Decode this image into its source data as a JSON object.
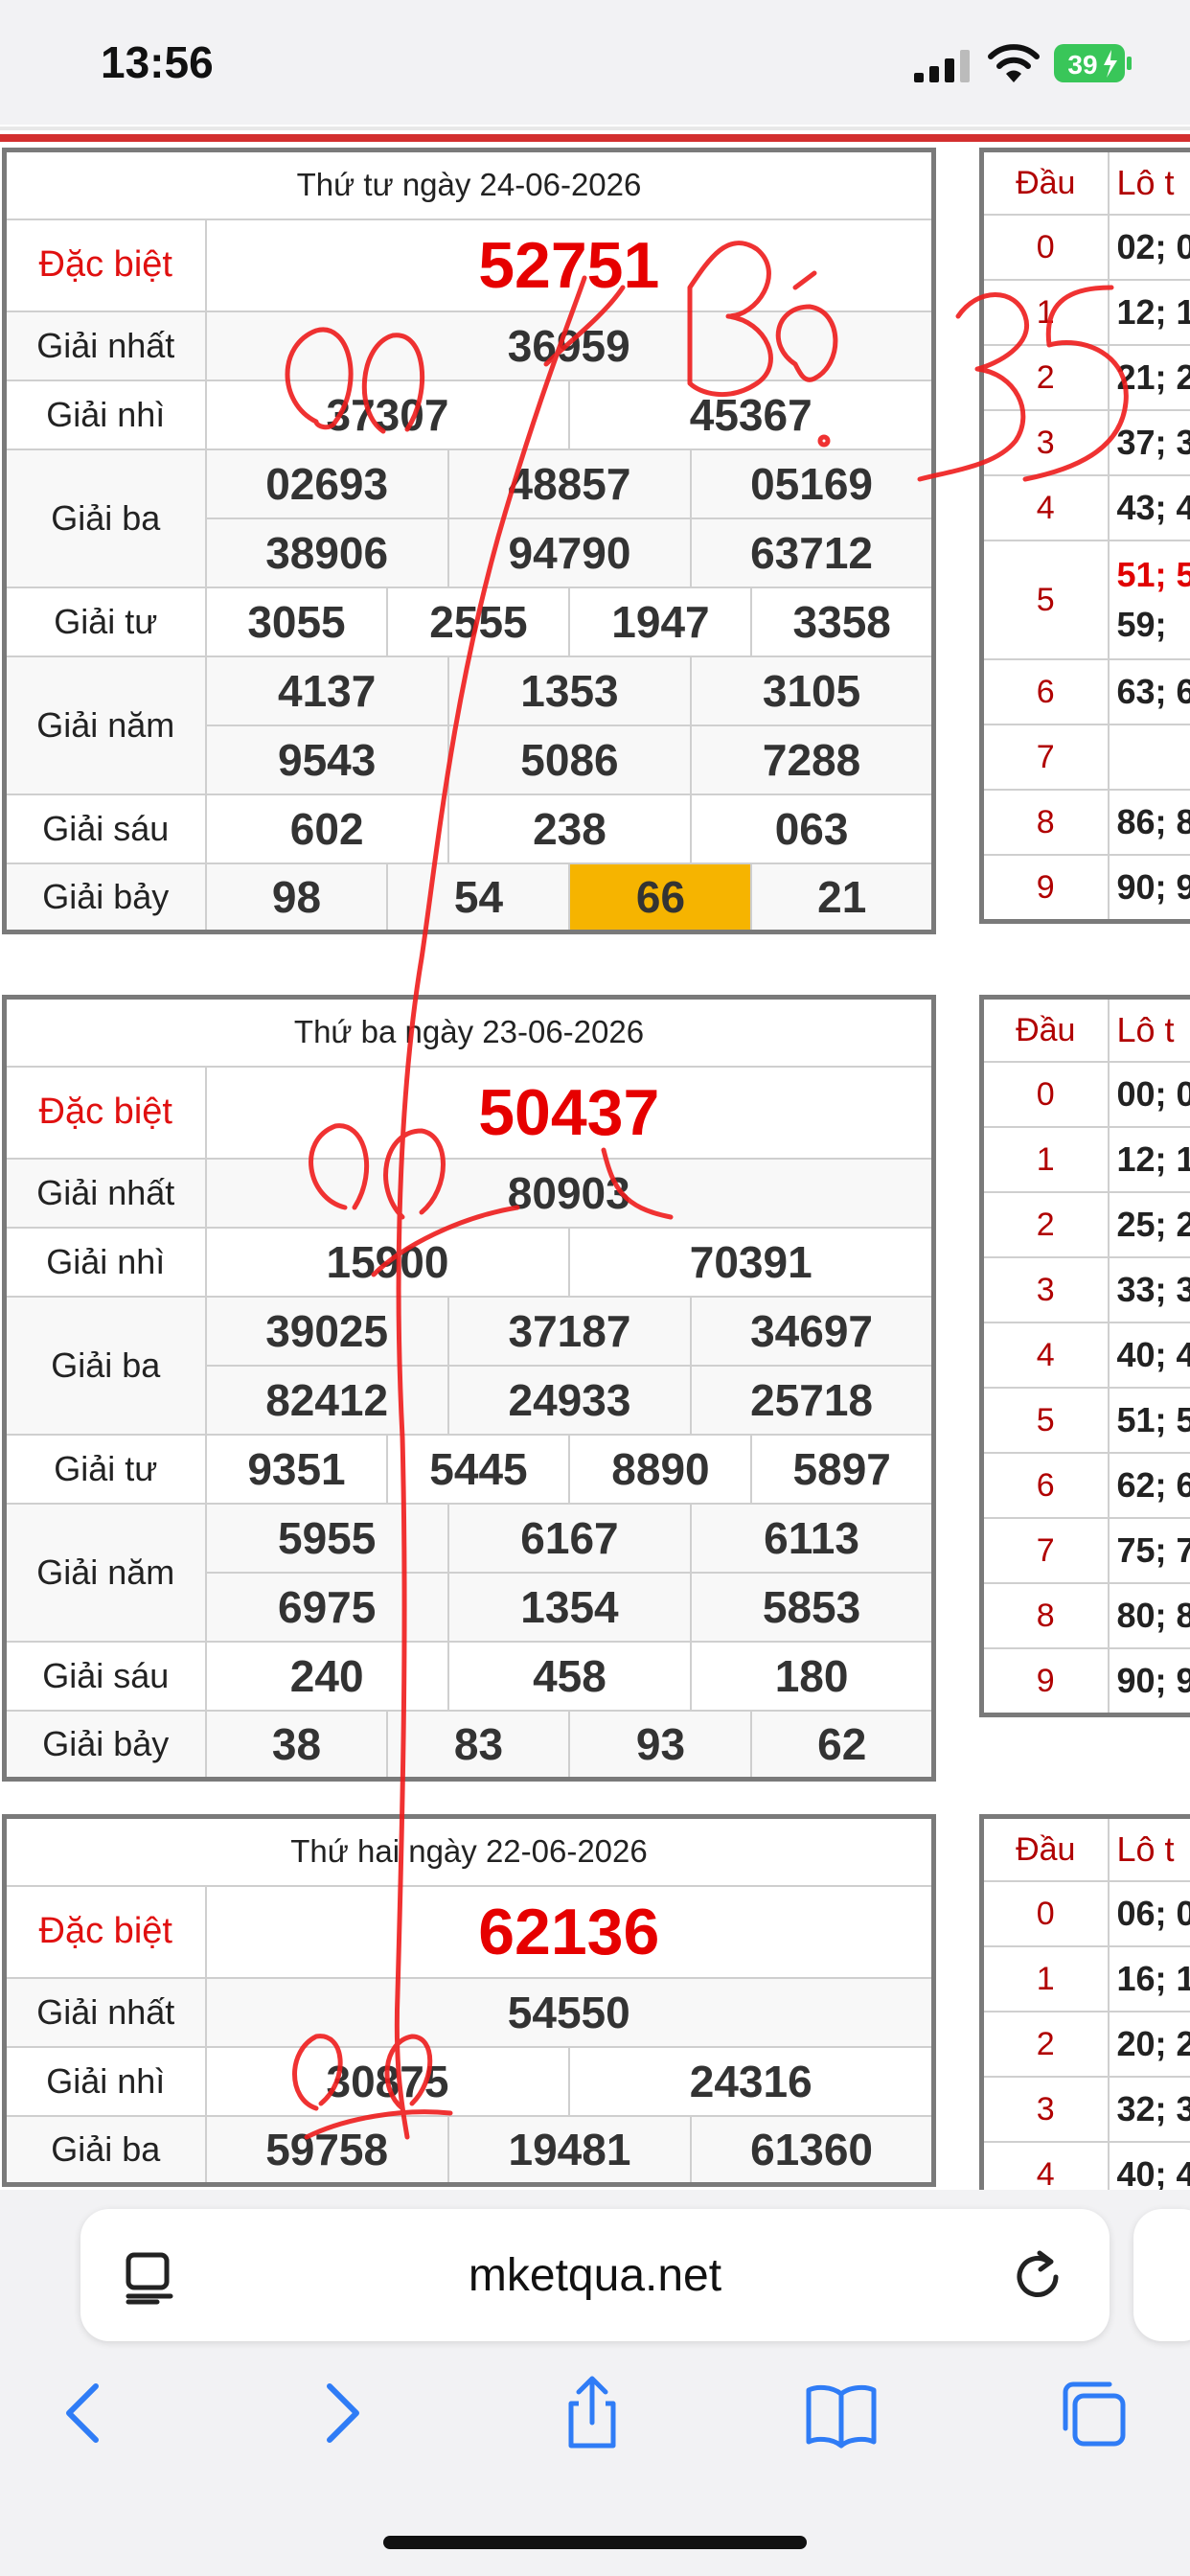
{
  "status_bar": {
    "time": "13:56",
    "battery": "39"
  },
  "days": [
    {
      "date": "Thứ tư ngày 24-06-2026",
      "labels": {
        "db": "Đặc biệt",
        "g1": "Giải nhất",
        "g2": "Giải nhì",
        "g3": "Giải ba",
        "g4": "Giải tư",
        "g5": "Giải năm",
        "g6": "Giải sáu",
        "g7": "Giải bảy"
      },
      "db": "52751",
      "g1": "36959",
      "g2": [
        "37307",
        "45367"
      ],
      "g3": [
        "02693",
        "48857",
        "05169",
        "38906",
        "94790",
        "63712"
      ],
      "g4": [
        "3055",
        "2555",
        "1947",
        "3358"
      ],
      "g5": [
        "4137",
        "1353",
        "3105",
        "9543",
        "5086",
        "7288"
      ],
      "g6": [
        "602",
        "238",
        "063"
      ],
      "g7": [
        "98",
        "54",
        "66",
        "21"
      ],
      "side": {
        "header": [
          "Đầu",
          "Lô t"
        ],
        "heads": [
          "0",
          "1",
          "2",
          "3",
          "4",
          "5",
          "6",
          "7",
          "8",
          "9"
        ],
        "loto": [
          "02; 0",
          "12; 1",
          "21; 2",
          "37; 3",
          "43; 4",
          "51; 5",
          "59;",
          "63; 6",
          "",
          "86; 8",
          "90; 9"
        ]
      }
    },
    {
      "date": "Thứ ba ngày 23-06-2026",
      "labels": {
        "db": "Đặc biệt",
        "g1": "Giải nhất",
        "g2": "Giải nhì",
        "g3": "Giải ba",
        "g4": "Giải tư",
        "g5": "Giải năm",
        "g6": "Giải sáu",
        "g7": "Giải bảy"
      },
      "db": "50437",
      "g1": "80903",
      "g2": [
        "15900",
        "70391"
      ],
      "g3": [
        "39025",
        "37187",
        "34697",
        "82412",
        "24933",
        "25718"
      ],
      "g4": [
        "9351",
        "5445",
        "8890",
        "5897"
      ],
      "g5": [
        "5955",
        "6167",
        "6113",
        "6975",
        "1354",
        "5853"
      ],
      "g6": [
        "240",
        "458",
        "180"
      ],
      "g7": [
        "38",
        "83",
        "93",
        "62"
      ],
      "side": {
        "header": [
          "Đầu",
          "Lô t"
        ],
        "heads": [
          "0",
          "1",
          "2",
          "3",
          "4",
          "5",
          "6",
          "7",
          "8",
          "9"
        ],
        "loto": [
          "00; 0",
          "12; 1",
          "25; 2",
          "33; 3",
          "40; 4",
          "51; 5",
          "62; 6",
          "75; 7",
          "80; 8",
          "90; 9"
        ]
      }
    },
    {
      "date": "Thứ hai ngày 22-06-2026",
      "labels": {
        "db": "Đặc biệt",
        "g1": "Giải nhất",
        "g2": "Giải nhì",
        "g3": "Giải ba"
      },
      "db": "62136",
      "g1": "54550",
      "g2": [
        "30875",
        "24316"
      ],
      "g3": [
        "59758",
        "19481",
        "61360"
      ],
      "side": {
        "header": [
          "Đầu",
          "Lô t"
        ],
        "heads": [
          "0",
          "1",
          "2",
          "3",
          "4"
        ],
        "loto": [
          "06; 0",
          "16; 1",
          "20; 2",
          "32; 3",
          "40; 4"
        ]
      }
    }
  ],
  "browser": {
    "url": "mketqua.net"
  },
  "colors": {
    "accent_red": "#e60000",
    "highlight": "#f6b400",
    "ios_blue": "#2f7cf6"
  }
}
